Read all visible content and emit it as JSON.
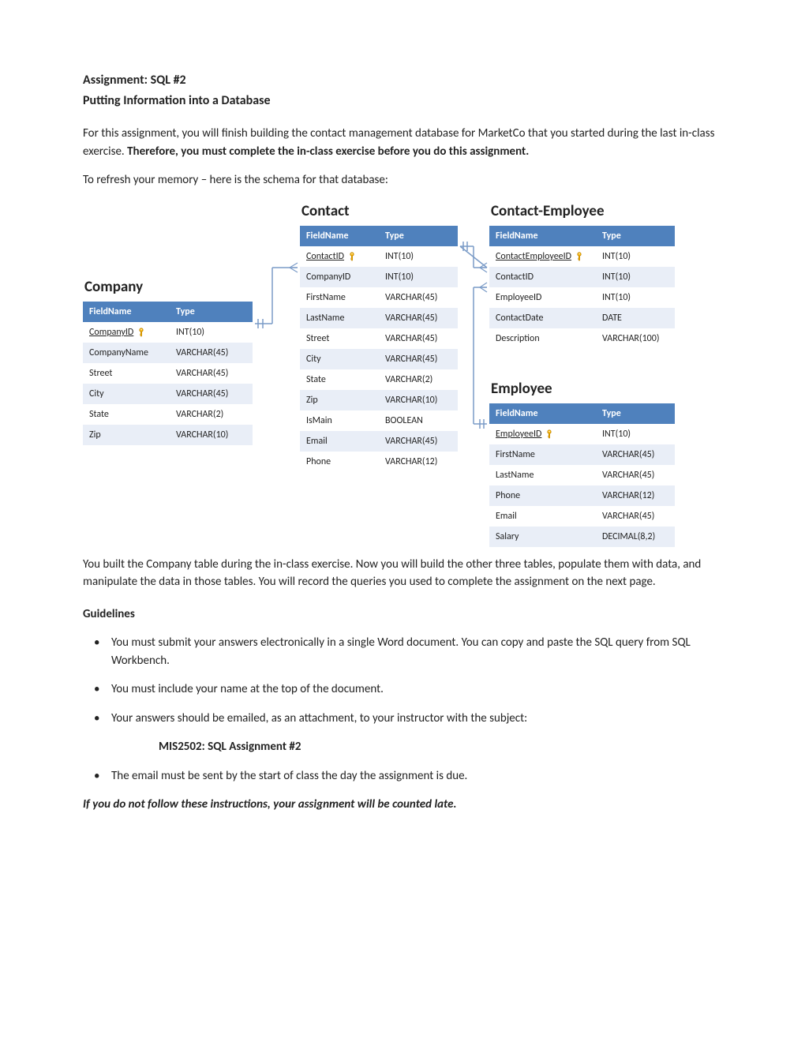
{
  "header": {
    "title": "Assignment: SQL #2",
    "subtitle": "Putting Information into a Database"
  },
  "intro": {
    "p1a": "For this assignment, you will finish building the contact management database for MarketCo that you started during the last in-class exercise. ",
    "p1b": "Therefore, you must complete the in-class exercise before you do this assignment.",
    "p2": "To refresh your memory – here is the schema for that database:"
  },
  "tables": {
    "company": {
      "title": "Company",
      "headers": [
        "FieldName",
        "Type"
      ],
      "rows": [
        {
          "name": "CompanyID",
          "type": "INT(10)",
          "pk": true
        },
        {
          "name": "CompanyName",
          "type": "VARCHAR(45)"
        },
        {
          "name": "Street",
          "type": "VARCHAR(45)"
        },
        {
          "name": "City",
          "type": "VARCHAR(45)"
        },
        {
          "name": "State",
          "type": "VARCHAR(2)"
        },
        {
          "name": "Zip",
          "type": "VARCHAR(10)"
        }
      ]
    },
    "contact": {
      "title": "Contact",
      "headers": [
        "FieldName",
        "Type"
      ],
      "rows": [
        {
          "name": "ContactID",
          "type": "INT(10)",
          "pk": true
        },
        {
          "name": "CompanyID",
          "type": "INT(10)"
        },
        {
          "name": "FirstName",
          "type": "VARCHAR(45)"
        },
        {
          "name": "LastName",
          "type": "VARCHAR(45)"
        },
        {
          "name": "Street",
          "type": "VARCHAR(45)"
        },
        {
          "name": "City",
          "type": "VARCHAR(45)"
        },
        {
          "name": "State",
          "type": "VARCHAR(2)"
        },
        {
          "name": "Zip",
          "type": "VARCHAR(10)"
        },
        {
          "name": "IsMain",
          "type": "BOOLEAN"
        },
        {
          "name": "Email",
          "type": "VARCHAR(45)"
        },
        {
          "name": "Phone",
          "type": "VARCHAR(12)"
        }
      ]
    },
    "contactEmployee": {
      "title": "Contact-Employee",
      "headers": [
        "FieldName",
        "Type"
      ],
      "rows": [
        {
          "name": "ContactEmployeeID",
          "type": "INT(10)",
          "pk": true
        },
        {
          "name": "ContactID",
          "type": "INT(10)"
        },
        {
          "name": "EmployeeID",
          "type": "INT(10)"
        },
        {
          "name": "ContactDate",
          "type": "DATE"
        },
        {
          "name": "Description",
          "type": "VARCHAR(100)"
        }
      ]
    },
    "employee": {
      "title": "Employee",
      "headers": [
        "FieldName",
        "Type"
      ],
      "rows": [
        {
          "name": "EmployeeID",
          "type": "INT(10)",
          "pk": true
        },
        {
          "name": "FirstName",
          "type": "VARCHAR(45)"
        },
        {
          "name": "LastName",
          "type": "VARCHAR(45)"
        },
        {
          "name": "Phone",
          "type": "VARCHAR(12)"
        },
        {
          "name": "Email",
          "type": "VARCHAR(45)"
        },
        {
          "name": "Salary",
          "type": "DECIMAL(8,2)"
        }
      ]
    }
  },
  "midPara": "You built the Company table during the in-class exercise. Now you will build the other three tables, populate them with data, and manipulate the data in those tables. You will record the queries you used to complete the assignment on the next page.",
  "guidelinesHeading": "Guidelines",
  "guidelines": {
    "g1": "You must submit your answers electronically in a single Word document. You can copy and paste the SQL query from SQL Workbench.",
    "g2": "You must include your name at the top of the document.",
    "g3": "Your answers should be emailed, as an attachment, to your instructor with the subject:",
    "subject": "MIS2502: SQL Assignment #2",
    "g4": "The email must be sent by the start of class the day the assignment is due."
  },
  "warning": "If you do not follow these instructions, your assignment will be counted late."
}
